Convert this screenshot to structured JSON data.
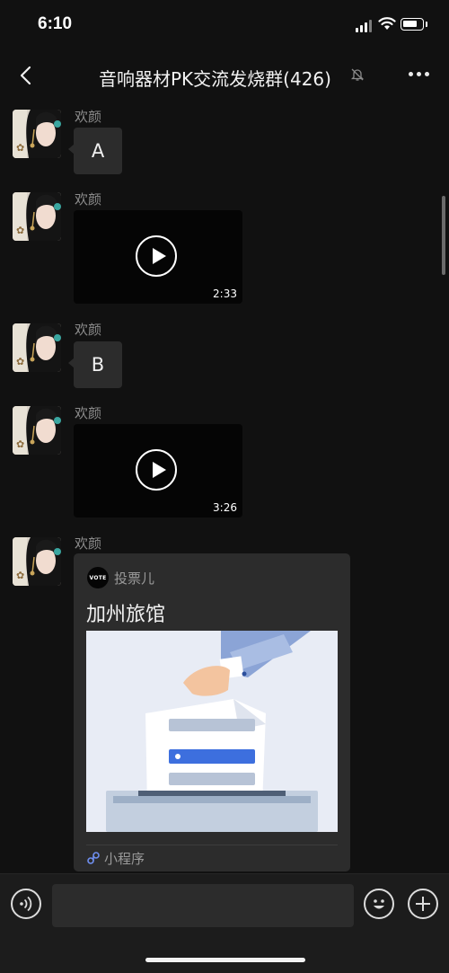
{
  "status_bar": {
    "time": "6:10"
  },
  "nav": {
    "title": "音响器材PK交流发烧群(426)"
  },
  "messages": [
    {
      "sender": "欢颜",
      "type": "text",
      "text": "A"
    },
    {
      "sender": "欢颜",
      "type": "video",
      "duration": "2:33"
    },
    {
      "sender": "欢颜",
      "type": "text",
      "text": "B"
    },
    {
      "sender": "欢颜",
      "type": "video",
      "duration": "3:26"
    },
    {
      "sender": "欢颜",
      "type": "mini_program",
      "logo_text": "VOTE",
      "app_name": "投票儿",
      "title": "加州旅馆",
      "footer_label": "小程序"
    }
  ],
  "input_bar": {
    "placeholder": ""
  },
  "colors": {
    "background": "#111111",
    "bubble": "#2c2c2c",
    "accent_blue": "#3d6fde",
    "sender_gray": "#8c8c8c"
  },
  "icons": [
    "back-arrow-icon",
    "mute-bell-icon",
    "more-dots-icon",
    "play-icon",
    "voice-icon",
    "emoji-icon",
    "plus-icon",
    "mini-program-link-icon"
  ]
}
